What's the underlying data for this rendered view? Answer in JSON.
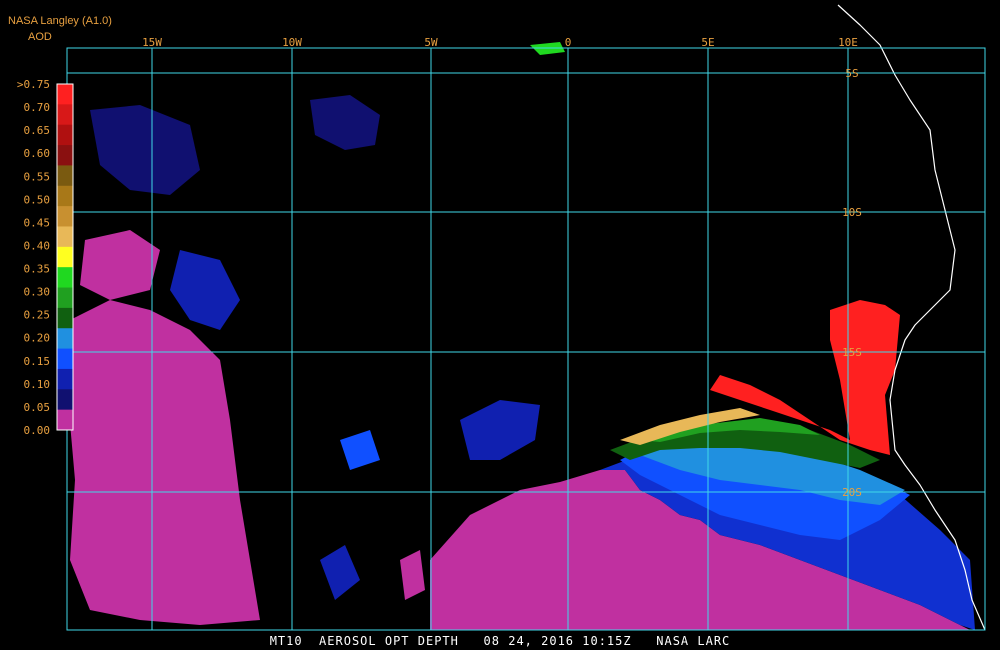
{
  "header": {
    "title": "NASA Langley (A1.0)",
    "subtitle": "AOD"
  },
  "footer": {
    "caption": "MT10  AEROSOL OPT DEPTH   08 24, 2016 10:15Z   NASA LARC"
  },
  "legend": {
    "labels": [
      ">0.75",
      "0.70",
      "0.65",
      "0.60",
      "0.55",
      "0.50",
      "0.45",
      "0.40",
      "0.35",
      "0.30",
      "0.25",
      "0.20",
      "0.15",
      "0.10",
      "0.05",
      "0.00"
    ],
    "colors": [
      "#ff2020",
      "#d81818",
      "#b01010",
      "#8a1010",
      "#7a5a10",
      "#a87818",
      "#c89030",
      "#e8b858",
      "#ffff20",
      "#20d820",
      "#20a020",
      "#106010",
      "#2090e0",
      "#1050ff",
      "#1020b0",
      "#101070",
      "#c030a0"
    ]
  },
  "map": {
    "longitude_labels": [
      "15W",
      "10W",
      "5W",
      "0",
      "5E",
      "10E"
    ],
    "latitude_labels": [
      "5S",
      "10S",
      "15S",
      "20S"
    ],
    "colors": {
      "grid": "#40d8e8",
      "coast": "#ffffff",
      "background": "#000000"
    }
  }
}
